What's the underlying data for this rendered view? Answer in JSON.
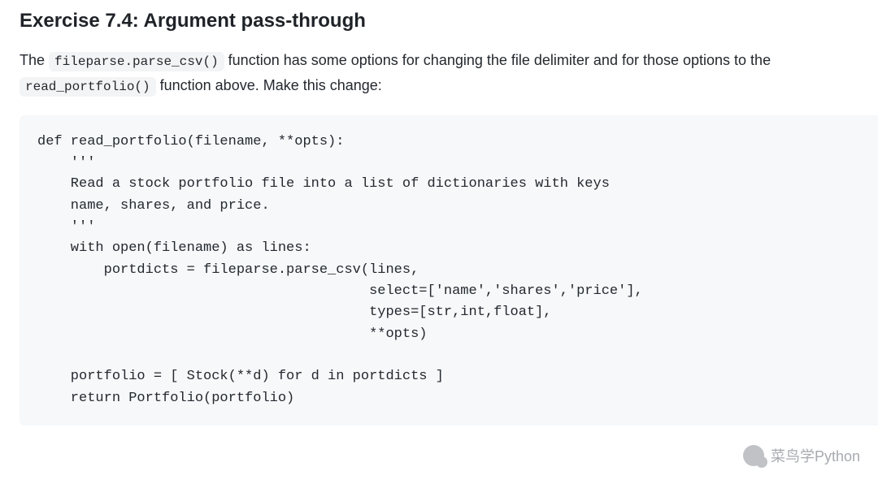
{
  "heading": "Exercise 7.4: Argument pass-through",
  "desc_parts": {
    "p1a": "The ",
    "code1": "fileparse.parse_csv()",
    "p1b": " function has some options for changing the file delimiter and for those options to the ",
    "code2": "read_portfolio()",
    "p1c": " function above. Make this change:"
  },
  "code": "def read_portfolio(filename, **opts):\n    '''\n    Read a stock portfolio file into a list of dictionaries with keys\n    name, shares, and price.\n    '''\n    with open(filename) as lines:\n        portdicts = fileparse.parse_csv(lines,\n                                        select=['name','shares','price'],\n                                        types=[str,int,float],\n                                        **opts)\n\n    portfolio = [ Stock(**d) for d in portdicts ]\n    return Portfolio(portfolio)",
  "watermark": "菜鸟学Python"
}
